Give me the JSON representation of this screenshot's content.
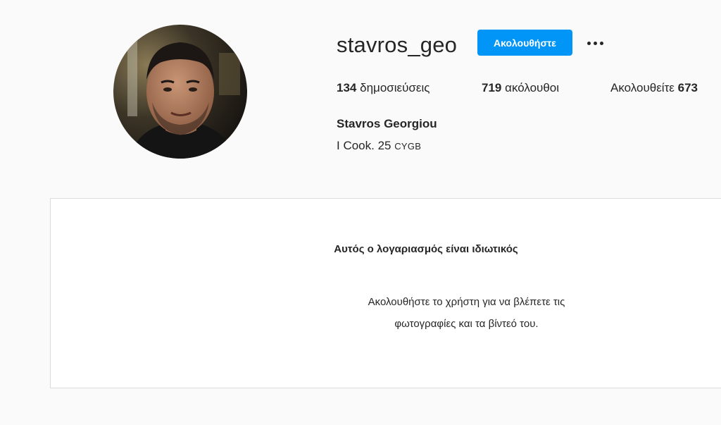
{
  "profile": {
    "username": "stavros_geo",
    "follow_label": "Ακολουθήστε",
    "more_icon": "more-options-icon",
    "posts_count": "134",
    "posts_label": "δημοσιεύσεις",
    "followers_count": "719",
    "followers_label": "ακόλουθοι",
    "following_label": "Ακολουθείτε",
    "following_count": "673",
    "full_name": "Stavros Georgiou",
    "bio_main": "I Cook. 25 ",
    "bio_smallcaps": "CYGB"
  },
  "private_notice": {
    "title": "Αυτός ο λογαριασμός είναι ιδιωτικός",
    "description": "Ακολουθήστε το χρήστη για να βλέπετε τις φωτογραφίες και τα βίντεό του."
  },
  "colors": {
    "accent": "#0095f6",
    "background": "#fafafa",
    "text": "#262626",
    "border": "#dbdbdb"
  }
}
